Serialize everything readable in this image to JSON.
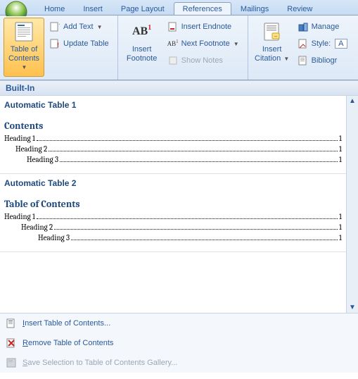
{
  "tabs": {
    "home": "Home",
    "insert": "Insert",
    "pagelayout": "Page Layout",
    "references": "References",
    "mailings": "Mailings",
    "review": "Review"
  },
  "ribbon": {
    "toc": {
      "line1": "Table of",
      "line2": "Contents"
    },
    "addtext": "Add Text",
    "updatetable": "Update Table",
    "footnote": {
      "line1": "Insert",
      "line2": "Footnote",
      "glyph": "AB",
      "sup": "1"
    },
    "insertendnote": "Insert Endnote",
    "nextfootnote": "Next Footnote",
    "shownotes": "Show Notes",
    "citation": {
      "line1": "Insert",
      "line2": "Citation"
    },
    "manage": "Manage",
    "style": "Style:",
    "stylevalue": "A",
    "bibliog": "Bibliogr"
  },
  "gallery": {
    "header": "Built-In",
    "auto1": {
      "title": "Automatic Table 1",
      "contents": "Contents",
      "h1": "Heading 1",
      "h2": "Heading 2",
      "h3": "Heading 3",
      "pg": "1"
    },
    "auto2": {
      "title": "Automatic Table 2",
      "contents": "Table of Contents",
      "h1": "Heading 1",
      "h2": "Heading 2",
      "h3": "Heading 3",
      "pg": "1"
    }
  },
  "menu": {
    "insert": "nsert Table of Contents...",
    "insert_accel": "I",
    "remove": "emove Table of Contents",
    "remove_accel": "R",
    "save": "ave Selection to Table of Contents Gallery...",
    "save_accel": "S"
  }
}
